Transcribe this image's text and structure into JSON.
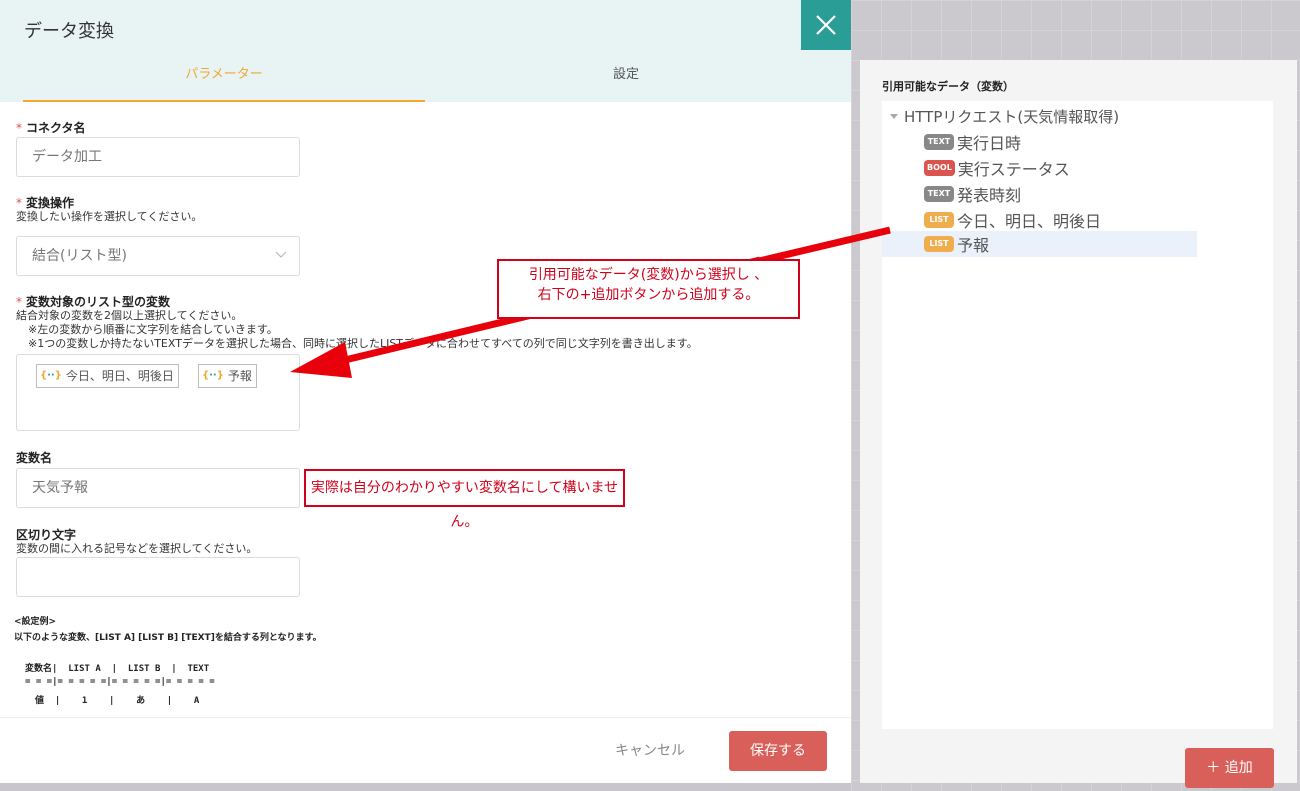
{
  "dialog": {
    "title": "データ変換",
    "tabs": [
      {
        "label": "パラメーター",
        "active": true
      },
      {
        "label": "設定",
        "active": false
      }
    ],
    "connector_name": {
      "label": "コネクタ名",
      "required_mark": "*",
      "value": "データ加工"
    },
    "operation": {
      "label": "変換操作",
      "required_mark": "*",
      "help": "変換したい操作を選択してください。",
      "value": "結合(リスト型)"
    },
    "list_vars": {
      "label": "変数対象のリスト型の変数",
      "required_mark": "*",
      "help": [
        "結合対象の変数を2個以上選択してください。",
        "※左の変数から順番に文字列を結合していきます。",
        "※1つの変数しか持たないTEXTデータを選択した場合、同時に選択したLISTデータに合わせてすべての列で同じ文字列を書き出します。"
      ],
      "tags": [
        {
          "icon": "{··}",
          "label": "今日、明日、明後日"
        },
        {
          "icon": "{··}",
          "label": "予報"
        }
      ]
    },
    "variable_name": {
      "label": "変数名",
      "value": "天気予報"
    },
    "separator": {
      "label": "区切り文字",
      "help": "変数の間に入れる記号などを選択してください。",
      "value": ""
    },
    "example": {
      "heading": "<設定例>",
      "description": "以下のような変数、[LIST A] [LIST B] [TEXT]を結合する列となります。",
      "rows": [
        "変数名|  LIST A  |  LIST B  |  TEXT",
        "= = =|= = = = =|= = = = =|= = = = =",
        "値  |    1    |    あ    |    A"
      ]
    },
    "cancel_label": "キャンセル",
    "save_label": "保存する",
    "close_icon": "close-icon"
  },
  "annotations": {
    "select_hint": "引用可能なデータ(変数)から選択し 、\n右下の+追加ボタンから追加する。",
    "name_hint": "実際は自分のわかりやすい変数名にして構いません。",
    "color": "#d0021b"
  },
  "right_panel": {
    "title": "引用可能なデータ（変数）",
    "root_label": "HTTPリクエスト(天気情報取得)",
    "items": [
      {
        "badge": "TEXT",
        "badge_color": "#888888",
        "label": "実行日時"
      },
      {
        "badge": "BOOL",
        "badge_color": "#d9534f",
        "label": "実行ステータス"
      },
      {
        "badge": "TEXT",
        "badge_color": "#888888",
        "label": "発表時刻"
      },
      {
        "badge": "LIST",
        "badge_color": "#f0ad4e",
        "label": "今日、明日、明後日"
      },
      {
        "badge": "LIST",
        "badge_color": "#f0ad4e",
        "label": "予報",
        "selected": true
      }
    ],
    "add_label": "＋ 追加"
  }
}
